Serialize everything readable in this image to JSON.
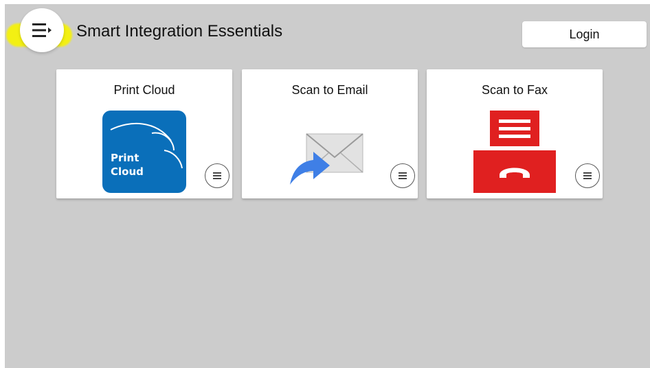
{
  "header": {
    "app_title": "Smart Integration Essentials",
    "login_label": "Login",
    "menu_icon": "hamburger-menu-icon"
  },
  "tiles": [
    {
      "label": "Print Cloud",
      "icon": "print-cloud-logo",
      "logo_text_line1": "Print",
      "logo_text_line2": "Cloud",
      "logo_color": "#0a6fba"
    },
    {
      "label": "Scan to Email",
      "icon": "envelope-forward-icon",
      "arrow_color": "#3f7fe6"
    },
    {
      "label": "Scan to Fax",
      "icon": "fax-icon",
      "fax_color": "#e02020"
    }
  ],
  "colors": {
    "background": "#cccccc",
    "highlight": "#f6f20a",
    "tile": "#ffffff"
  }
}
